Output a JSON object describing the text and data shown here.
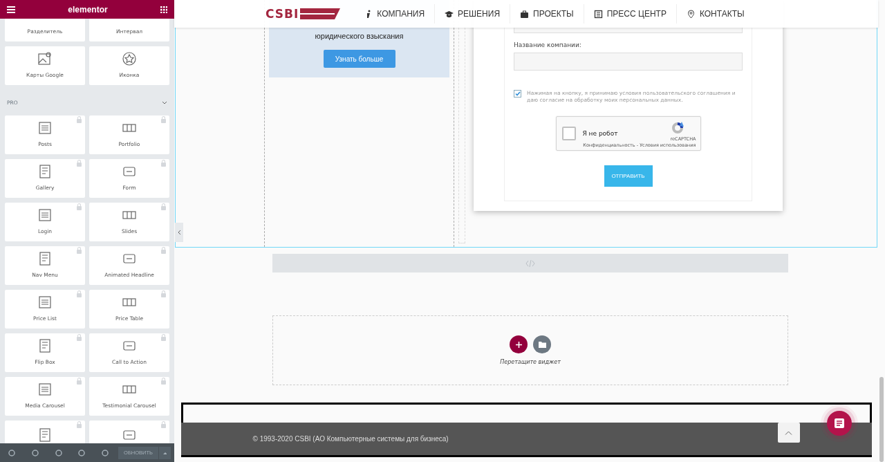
{
  "editor_panel": {
    "brand": "elementor",
    "section_title": "PRO",
    "widgets": [
      {
        "label": "Разделитель",
        "locked": false
      },
      {
        "label": "Интервал",
        "locked": false
      },
      {
        "label": "Карты Google",
        "locked": false
      },
      {
        "label": "Иконка",
        "locked": false
      }
    ],
    "pro_widgets": [
      {
        "label": "Posts",
        "locked": true
      },
      {
        "label": "Portfolio",
        "locked": true
      },
      {
        "label": "Gallery",
        "locked": true
      },
      {
        "label": "Form",
        "locked": true
      },
      {
        "label": "Login",
        "locked": true
      },
      {
        "label": "Slides",
        "locked": true
      },
      {
        "label": "Nav Menu",
        "locked": true
      },
      {
        "label": "Animated Headline",
        "locked": true
      },
      {
        "label": "Price List",
        "locked": true
      },
      {
        "label": "Price Table",
        "locked": true
      },
      {
        "label": "Flip Box",
        "locked": true
      },
      {
        "label": "Call to Action",
        "locked": true
      },
      {
        "label": "Media Carousel",
        "locked": true
      },
      {
        "label": "Testimonial Carousel",
        "locked": true
      },
      {
        "locked": true
      },
      {
        "locked": true
      }
    ],
    "update_button": "ОБНОВИТЬ"
  },
  "site_header": {
    "logo": "CSBI",
    "nav": [
      {
        "label": "КОМПАНИЯ"
      },
      {
        "label": "РЕШЕНИЯ"
      },
      {
        "label": "ПРОЕКТЫ"
      },
      {
        "label": "ПРЕСС ЦЕНТР"
      },
      {
        "label": "КОНТАКТЫ"
      }
    ]
  },
  "promo_card": {
    "text": "юридического взыскания",
    "button": "Узнать больше"
  },
  "form": {
    "company_label": "Название компании:",
    "consent_checked": true,
    "consent_text": "Нажимая на кнопку, я принимаю условия пользовательского соглашения и даю согласие на обработку моих персональных данных.",
    "captcha": {
      "checked": false,
      "label": "Я не робот",
      "brand": "reCAPTCHA",
      "links": "Конфиденциальность - Условия использования"
    },
    "submit": "ОТПРАВИТЬ"
  },
  "drop_zone": {
    "hint": "Перетащите виджет"
  },
  "footer": {
    "copyright": "© 1993-2020 CSBI (АО Компьютерные системы для бизнеса)"
  }
}
